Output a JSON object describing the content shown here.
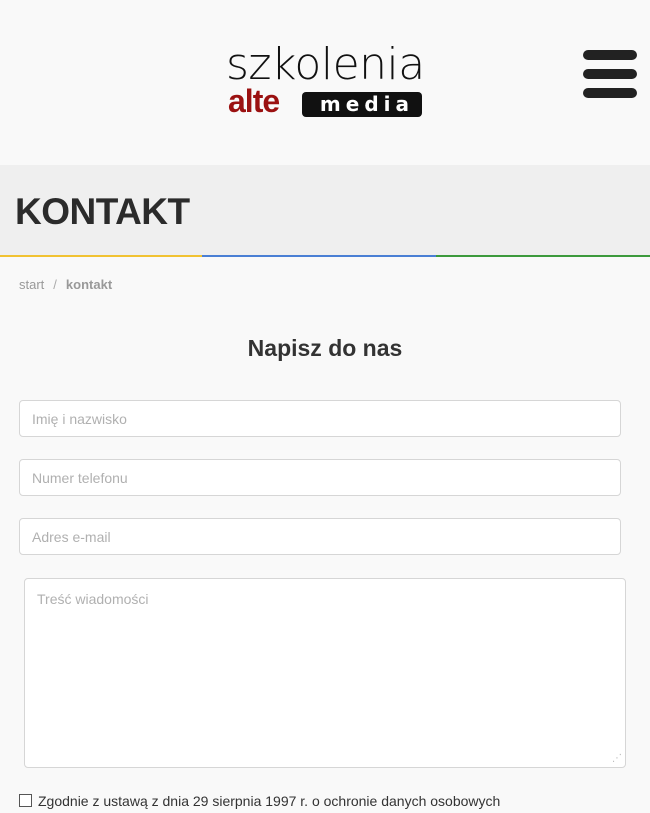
{
  "header": {
    "logo_top": "szkolenia",
    "logo_alte": "alte",
    "logo_media": "media",
    "menu_icon": "hamburger-menu-icon"
  },
  "page": {
    "title": "KONTAKT",
    "accent_colors": [
      "#f1c232",
      "#4a7fd4",
      "#3c9a3c"
    ]
  },
  "breadcrumb": {
    "home": "start",
    "separator": "/",
    "current": "kontakt"
  },
  "form": {
    "title": "Napisz do nas",
    "name_placeholder": "Imię i nazwisko",
    "phone_placeholder": "Numer telefonu",
    "email_placeholder": "Adres e-mail",
    "message_placeholder": "Treść wiadomości",
    "consent_text": "Zgodnie z ustawą z dnia 29 sierpnia 1997 r. o ochronie danych osobowych"
  }
}
